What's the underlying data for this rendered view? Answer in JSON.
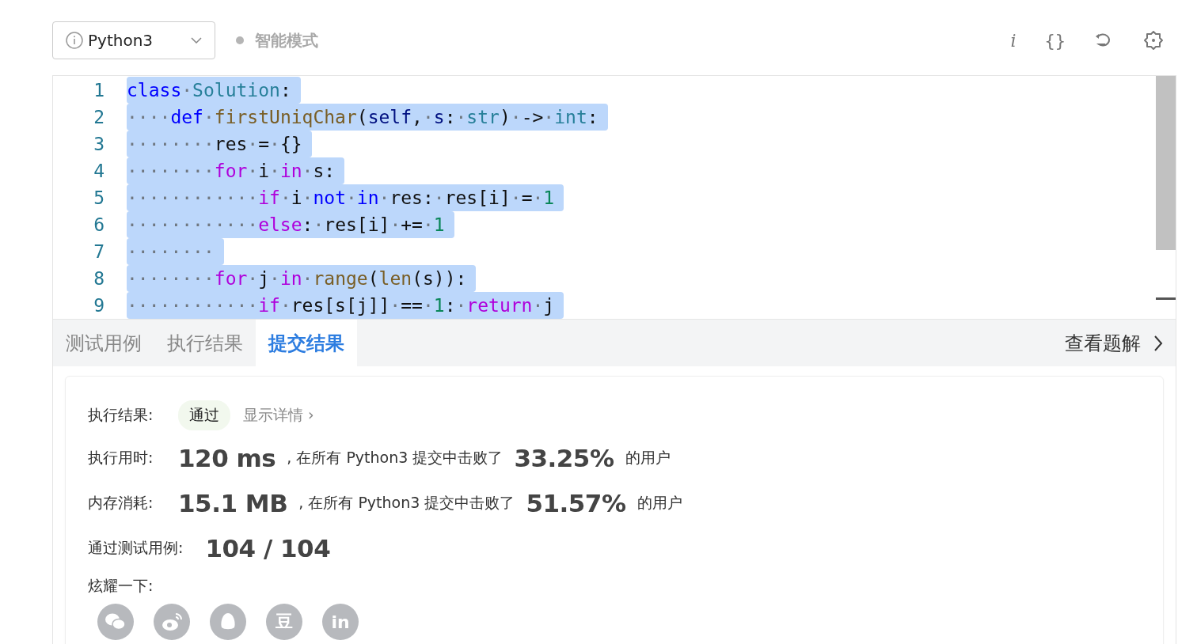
{
  "toolbar": {
    "language": "Python3",
    "mode": "智能模式",
    "mode_on": false,
    "actions": [
      {
        "kind": "info",
        "label": "i"
      },
      {
        "kind": "format",
        "label": "{}"
      },
      {
        "kind": "reset"
      },
      {
        "kind": "settings"
      }
    ]
  },
  "editor": {
    "lines": [
      {
        "number": "1",
        "selected": true,
        "tokens": [
          {
            "kind": "kw",
            "text": "class"
          },
          {
            "kind": "ws",
            "text": "·"
          },
          {
            "kind": "cls",
            "text": "Solution"
          },
          {
            "kind": "plain",
            "text": ":"
          }
        ]
      },
      {
        "number": "2",
        "selected": true,
        "tokens": [
          {
            "kind": "ws",
            "text": "····"
          },
          {
            "kind": "kw",
            "text": "def"
          },
          {
            "kind": "ws",
            "text": "·"
          },
          {
            "kind": "fn",
            "text": "firstUniqChar"
          },
          {
            "kind": "plain",
            "text": "("
          },
          {
            "kind": "param",
            "text": "self"
          },
          {
            "kind": "plain",
            "text": ","
          },
          {
            "kind": "ws",
            "text": "·"
          },
          {
            "kind": "param",
            "text": "s"
          },
          {
            "kind": "plain",
            "text": ":"
          },
          {
            "kind": "ws",
            "text": "·"
          },
          {
            "kind": "cls",
            "text": "str"
          },
          {
            "kind": "plain",
            "text": ")"
          },
          {
            "kind": "ws",
            "text": "·"
          },
          {
            "kind": "plain",
            "text": "->"
          },
          {
            "kind": "ws",
            "text": "·"
          },
          {
            "kind": "cls",
            "text": "int"
          },
          {
            "kind": "plain",
            "text": ":"
          }
        ]
      },
      {
        "number": "3",
        "selected": true,
        "tokens": [
          {
            "kind": "ws",
            "text": "········"
          },
          {
            "kind": "plain",
            "text": "res"
          },
          {
            "kind": "ws",
            "text": "·"
          },
          {
            "kind": "plain",
            "text": "="
          },
          {
            "kind": "ws",
            "text": "·"
          },
          {
            "kind": "plain",
            "text": "{}"
          }
        ]
      },
      {
        "number": "4",
        "selected": true,
        "tokens": [
          {
            "kind": "ws",
            "text": "········"
          },
          {
            "kind": "ctl",
            "text": "for"
          },
          {
            "kind": "ws",
            "text": "·"
          },
          {
            "kind": "plain",
            "text": "i"
          },
          {
            "kind": "ws",
            "text": "·"
          },
          {
            "kind": "ctl",
            "text": "in"
          },
          {
            "kind": "ws",
            "text": "·"
          },
          {
            "kind": "plain",
            "text": "s:"
          }
        ]
      },
      {
        "number": "5",
        "selected": true,
        "tokens": [
          {
            "kind": "ws",
            "text": "············"
          },
          {
            "kind": "ctl",
            "text": "if"
          },
          {
            "kind": "ws",
            "text": "·"
          },
          {
            "kind": "plain",
            "text": "i"
          },
          {
            "kind": "ws",
            "text": "·"
          },
          {
            "kind": "kw",
            "text": "not"
          },
          {
            "kind": "ws",
            "text": "·"
          },
          {
            "kind": "kw",
            "text": "in"
          },
          {
            "kind": "ws",
            "text": "·"
          },
          {
            "kind": "plain",
            "text": "res:"
          },
          {
            "kind": "ws",
            "text": "·"
          },
          {
            "kind": "plain",
            "text": "res[i]"
          },
          {
            "kind": "ws",
            "text": "·"
          },
          {
            "kind": "plain",
            "text": "="
          },
          {
            "kind": "ws",
            "text": "·"
          },
          {
            "kind": "num",
            "text": "1"
          }
        ]
      },
      {
        "number": "6",
        "selected": true,
        "tokens": [
          {
            "kind": "ws",
            "text": "············"
          },
          {
            "kind": "ctl",
            "text": "else"
          },
          {
            "kind": "plain",
            "text": ":"
          },
          {
            "kind": "ws",
            "text": "·"
          },
          {
            "kind": "plain",
            "text": "res[i]"
          },
          {
            "kind": "ws",
            "text": "·"
          },
          {
            "kind": "plain",
            "text": "+="
          },
          {
            "kind": "ws",
            "text": "·"
          },
          {
            "kind": "num",
            "text": "1"
          }
        ]
      },
      {
        "number": "7",
        "selected": true,
        "tokens": [
          {
            "kind": "ws",
            "text": "········"
          }
        ]
      },
      {
        "number": "8",
        "selected": true,
        "tokens": [
          {
            "kind": "ws",
            "text": "········"
          },
          {
            "kind": "ctl",
            "text": "for"
          },
          {
            "kind": "ws",
            "text": "·"
          },
          {
            "kind": "plain",
            "text": "j"
          },
          {
            "kind": "ws",
            "text": "·"
          },
          {
            "kind": "ctl",
            "text": "in"
          },
          {
            "kind": "ws",
            "text": "·"
          },
          {
            "kind": "fn",
            "text": "range"
          },
          {
            "kind": "plain",
            "text": "("
          },
          {
            "kind": "fn",
            "text": "len"
          },
          {
            "kind": "plain",
            "text": "(s)):"
          }
        ]
      },
      {
        "number": "9",
        "selected": true,
        "tokens": [
          {
            "kind": "ws",
            "text": "············"
          },
          {
            "kind": "ctl",
            "text": "if"
          },
          {
            "kind": "ws",
            "text": "·"
          },
          {
            "kind": "plain",
            "text": "res[s[j]]"
          },
          {
            "kind": "ws",
            "text": "·"
          },
          {
            "kind": "plain",
            "text": "=="
          },
          {
            "kind": "ws",
            "text": "·"
          },
          {
            "kind": "num",
            "text": "1"
          },
          {
            "kind": "plain",
            "text": ":"
          },
          {
            "kind": "ws",
            "text": "·"
          },
          {
            "kind": "ctl",
            "text": "return"
          },
          {
            "kind": "ws",
            "text": "·"
          },
          {
            "kind": "plain",
            "text": "j"
          }
        ]
      }
    ]
  },
  "tabs": [
    {
      "label": "测试用例",
      "selected": false
    },
    {
      "label": "执行结果",
      "selected": false
    },
    {
      "label": "提交结果",
      "selected": true
    }
  ],
  "solution_link": "查看题解",
  "result": {
    "status_label": "执行结果:",
    "status": "通过",
    "details_link": "显示详情 ›",
    "stats": [
      {
        "label": "执行用时:",
        "value": "120 ms",
        "text": ", 在所有 Python3 提交中击败了",
        "percent": "33.25%",
        "suffix": "的用户"
      },
      {
        "label": "内存消耗:",
        "value": "15.1 MB",
        "text": ", 在所有 Python3 提交中击败了",
        "percent": "51.57%",
        "suffix": "的用户"
      }
    ],
    "cases_label": "通过测试用例:",
    "cases": "104 / 104",
    "share_label": "炫耀一下:",
    "share": [
      {
        "kind": "wechat"
      },
      {
        "kind": "weibo"
      },
      {
        "kind": "qq"
      },
      {
        "kind": "text",
        "label": "豆"
      },
      {
        "kind": "text",
        "label": "in"
      }
    ]
  }
}
